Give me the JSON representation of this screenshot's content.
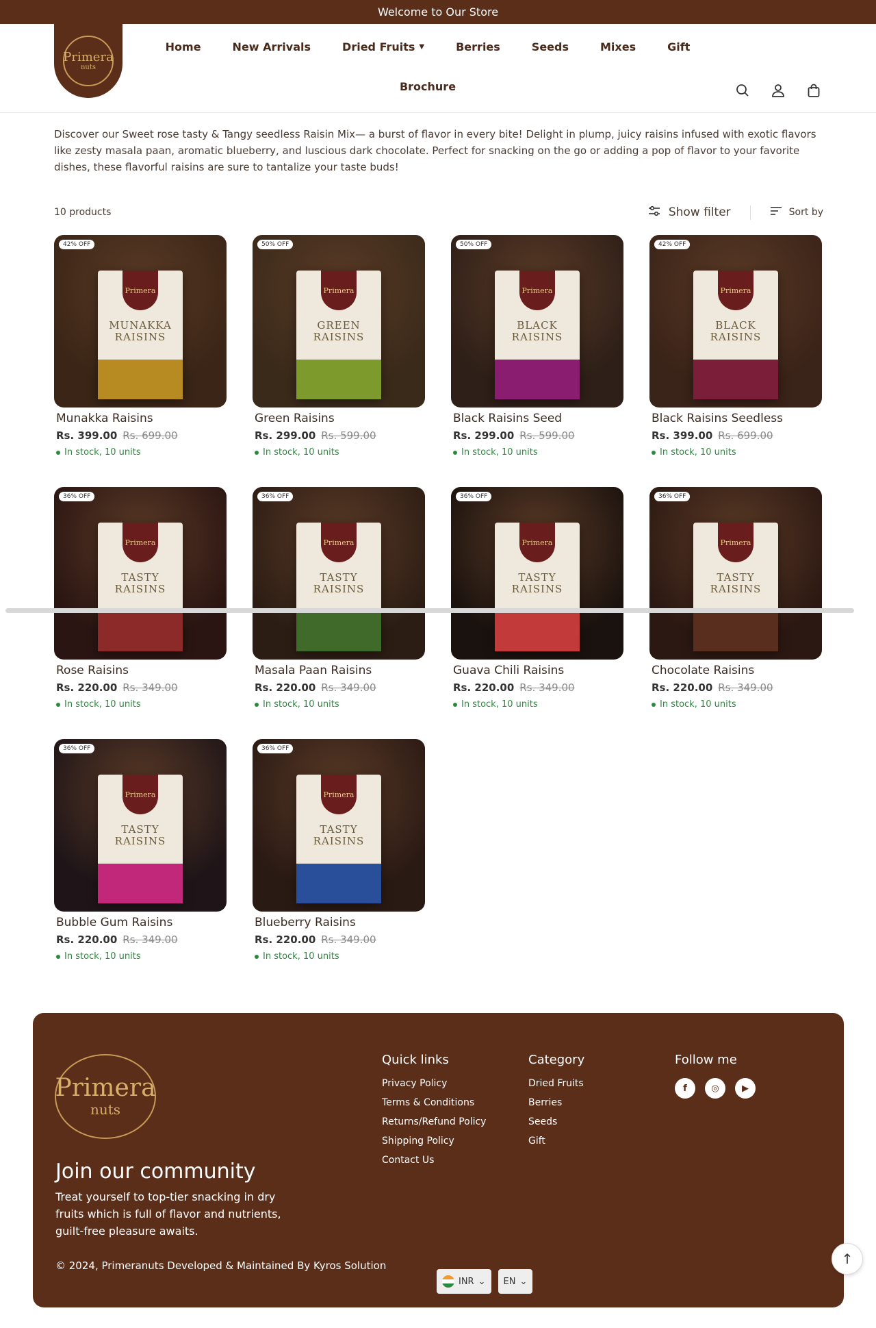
{
  "announcement": "Welcome to Our Store",
  "brand": {
    "name": "Primera",
    "sub": "nuts"
  },
  "nav": [
    {
      "label": "Home"
    },
    {
      "label": "New Arrivals"
    },
    {
      "label": "Dried Fruits",
      "has_dropdown": true
    },
    {
      "label": "Berries"
    },
    {
      "label": "Seeds"
    },
    {
      "label": "Mixes"
    },
    {
      "label": "Gift"
    },
    {
      "label": "Brochure"
    }
  ],
  "header_icons": [
    "search-icon",
    "account-icon",
    "cart-icon"
  ],
  "description": "Discover our Sweet rose tasty & Tangy seedless Raisin Mix— a burst of flavor in every bite! Delight in plump, juicy raisins infused with exotic flavors like zesty masala paan, aromatic blueberry, and luscious dark chocolate. Perfect for snacking on the go or adding a pop of flavor to your favorite dishes, these flavorful raisins are sure to tantalize your taste buds!",
  "toolbar": {
    "count": "10 products",
    "filter": "Show filter",
    "sort": "Sort by"
  },
  "products": [
    {
      "name": "Munakka Raisins",
      "price": "Rs. 399.00",
      "old": "Rs. 699.00",
      "badge": "42% OFF",
      "stock": "In stock, 10 units",
      "label": "MUNAKKA RAISINS",
      "bg": "#3a2516",
      "stripe": "#b88a22"
    },
    {
      "name": "Green Raisins",
      "price": "Rs. 299.00",
      "old": "Rs. 599.00",
      "badge": "50% OFF",
      "stock": "In stock, 10 units",
      "label": "GREEN RAISINS",
      "bg": "#3a2a1a",
      "stripe": "#7d9a2c"
    },
    {
      "name": "Black Raisins Seed",
      "price": "Rs. 299.00",
      "old": "Rs. 599.00",
      "badge": "50% OFF",
      "stock": "In stock, 10 units",
      "label": "BLACK RAISINS",
      "bg": "#2e1f18",
      "stripe": "#8a1d6f"
    },
    {
      "name": "Black Raisins Seedless",
      "price": "Rs. 399.00",
      "old": "Rs. 699.00",
      "badge": "42% OFF",
      "stock": "In stock, 10 units",
      "label": "BLACK RAISINS",
      "bg": "#3a2318",
      "stripe": "#7a1e3a"
    },
    {
      "name": "Rose Raisins",
      "price": "Rs. 220.00",
      "old": "Rs. 349.00",
      "badge": "36% OFF",
      "stock": "In stock, 10 units",
      "label": "TASTY RAISINS",
      "bg": "#2a1512",
      "stripe": "#8c2a2a"
    },
    {
      "name": "Masala Paan Raisins",
      "price": "Rs. 220.00",
      "old": "Rs. 349.00",
      "badge": "36% OFF",
      "stock": "In stock, 10 units",
      "label": "TASTY RAISINS",
      "bg": "#2c1d14",
      "stripe": "#3f6a2a"
    },
    {
      "name": "Guava Chili Raisins",
      "price": "Rs. 220.00",
      "old": "Rs. 349.00",
      "badge": "36% OFF",
      "stock": "In stock, 10 units",
      "label": "TASTY RAISINS",
      "bg": "#1a120e",
      "stripe": "#c23a3a"
    },
    {
      "name": "Chocolate Raisins",
      "price": "Rs. 220.00",
      "old": "Rs. 349.00",
      "badge": "36% OFF",
      "stock": "In stock, 10 units",
      "label": "TASTY RAISINS",
      "bg": "#2b1812",
      "stripe": "#5a2e1e"
    },
    {
      "name": "Bubble Gum Raisins",
      "price": "Rs. 220.00",
      "old": "Rs. 349.00",
      "badge": "36% OFF",
      "stock": "In stock, 10 units",
      "label": "TASTY RAISINS",
      "bg": "#1f1518",
      "stripe": "#c2287a"
    },
    {
      "name": "Blueberry Raisins",
      "price": "Rs. 220.00",
      "old": "Rs. 349.00",
      "badge": "36% OFF",
      "stock": "In stock, 10 units",
      "label": "TASTY RAISINS",
      "bg": "#2a1a14",
      "stripe": "#2a4f9a"
    }
  ],
  "footer": {
    "brand_name": "Primera",
    "brand_sub": "nuts",
    "join_title": "Join our community",
    "join_text": "Treat yourself to top-tier snacking in dry fruits which is full of flavor and nutrients, guilt-free pleasure awaits.",
    "quick_title": "Quick links",
    "quick_links": [
      "Privacy Policy",
      "Terms & Conditions",
      "Returns/Refund Policy",
      "Shipping Policy",
      "Contact Us"
    ],
    "category_title": "Category",
    "categories": [
      "Dried Fruits",
      "Berries",
      "Seeds",
      "Gift"
    ],
    "follow_title": "Follow me",
    "social": [
      "f",
      "◎",
      "▶"
    ],
    "copyright": "© 2024, Primeranuts Developed & Maintained By Kyros Solution",
    "currency": "INR",
    "language": "EN"
  },
  "colors": {
    "brand": "#5b2e1a",
    "stock": "#2c8a3f"
  }
}
